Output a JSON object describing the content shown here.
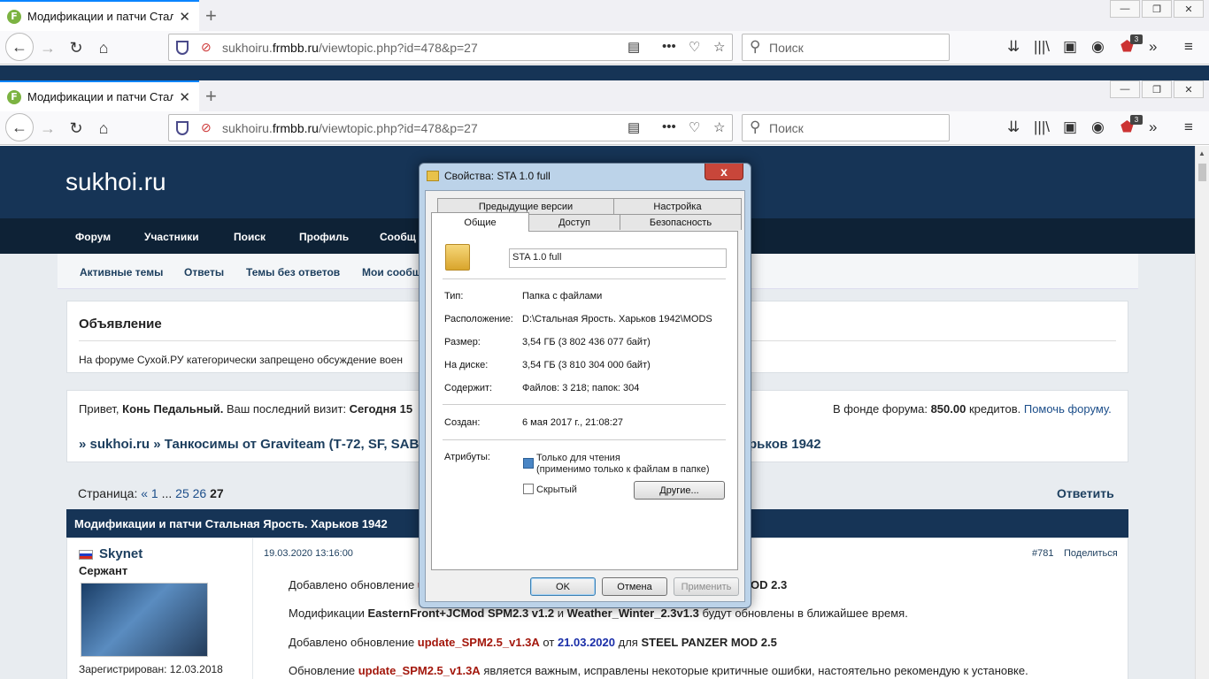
{
  "browser": {
    "tab_title": "Модификации и патчи Стальн",
    "url_host": "sukhoiru.",
    "url_domain": "frmbb.ru",
    "url_path": "/viewtopic.php?id=478&p=27",
    "search_placeholder": "Поиск",
    "badge": "3"
  },
  "site": {
    "logo": "sukhoi.ru",
    "menu": [
      "Форум",
      "Участники",
      "Поиск",
      "Профиль",
      "Сообщ"
    ],
    "submenu": [
      "Активные темы",
      "Ответы",
      "Темы без ответов",
      "Мои сообщ"
    ]
  },
  "announcement": {
    "title": "Объявление",
    "text": "На форуме Сухой.РУ категорически запрещено обсуждение воен"
  },
  "welcome": {
    "greeting": "Привет, ",
    "user": "Конь Педальный.",
    "last_visit_label": "  Ваш последний визит: ",
    "last_visit": "Сегодня 15",
    "fund_text": "В фонде форума: ",
    "fund_amount": "850.00",
    "fund_unit": " кредитов. ",
    "help": "Помочь форуму."
  },
  "breadcrumb": {
    "a": "» sukhoi.ru",
    "b": "» Танкосимы от Graviteam (Т-72, SF, SABO",
    "c": "рьков 1942"
  },
  "pagination": {
    "label": "Страница:",
    "prev": "«",
    "p1": "1",
    "dots": "...",
    "p25": "25",
    "p26": "26",
    "current": "27",
    "reply": "Ответить"
  },
  "topic_title": "Модификации и патчи Стальная Ярость. Харьков 1942",
  "post": {
    "author": "Skynet",
    "rank": "Сержант",
    "registered": "Зарегистрирован: 12.03.2018",
    "date": "19.03.2020 13:16:00",
    "num": "#781",
    "share": "Поделиться",
    "l1a": "Добавлено обновление ",
    "l1b": "u",
    "l1c": "OD 2.3",
    "l2a": "Модификации ",
    "l2b": "EasternFront+JCMod SPM2.3 v1.2",
    "l2c": " и ",
    "l2d": "Weather_Winter_2.3v1.3",
    "l2e": " будут обновлены в ближайшее время.",
    "l3a": "Добавлено обновление ",
    "l3b": "update_SPM2.5_v1.3A",
    "l3c": " от ",
    "l3d": "21.03.2020",
    "l3e": " для ",
    "l3f": "STEEL PANZER MOD 2.5",
    "l4a": "Обновление ",
    "l4b": "update_SPM2.5_v1.3A",
    "l4c": " является важным, исправлены некоторые критичные ошибки, настоятельно рекомендую к установке."
  },
  "dialog": {
    "title": "Свойства: STA 1.0 full",
    "close": "x",
    "tabs_top": [
      "Предыдущие версии",
      "Настройка"
    ],
    "tabs_bottom": [
      "Общие",
      "Доступ",
      "Безопасность"
    ],
    "name": "STA 1.0 full",
    "rows": [
      {
        "label": "Тип:",
        "value": "Папка с файлами"
      },
      {
        "label": "Расположение:",
        "value": "D:\\Стальная Ярость. Харьков 1942\\MODS"
      },
      {
        "label": "Размер:",
        "value": "3,54 ГБ (3 802 436 077 байт)"
      },
      {
        "label": "На диске:",
        "value": "3,54 ГБ (3 810 304 000 байт)"
      },
      {
        "label": "Содержит:",
        "value": "Файлов: 3 218; папок: 304"
      }
    ],
    "created_label": "Создан:",
    "created": "6 мая 2017 г., 21:08:27",
    "attr_label": "Атрибуты:",
    "readonly": "Только для чтения",
    "readonly_note": "(применимо только к файлам в папке)",
    "hidden": "Скрытый",
    "other": "Другие...",
    "ok": "OK",
    "cancel": "Отмена",
    "apply": "Применить"
  }
}
